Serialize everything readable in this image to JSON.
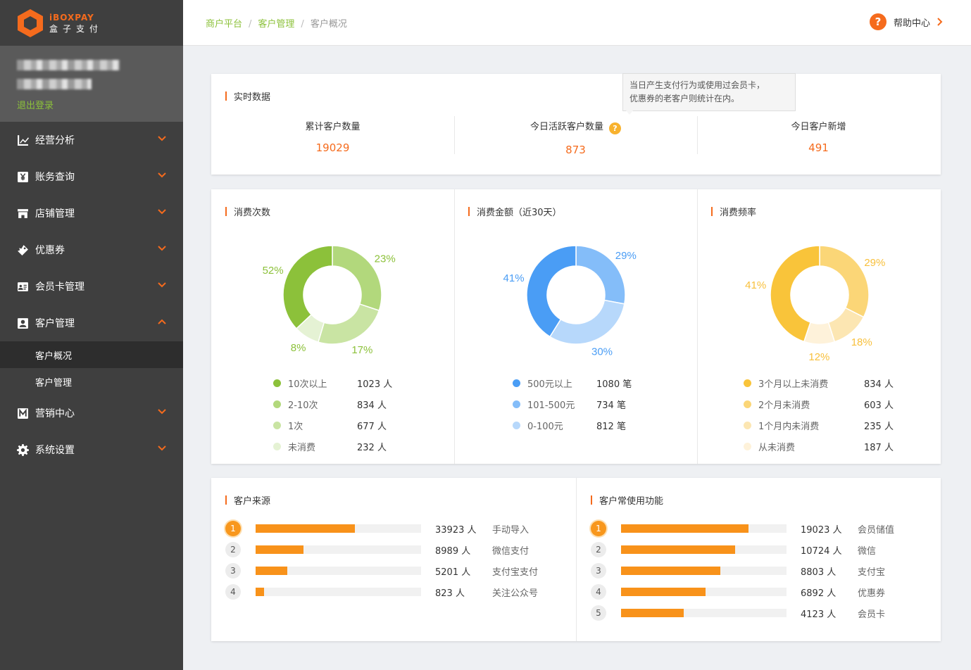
{
  "brand": {
    "logo_text": "iBOXPAY",
    "logo_cn": "盒子支付",
    "accent": "#f56b1d"
  },
  "sidebar": {
    "logout": "退出登录",
    "items": [
      {
        "label": "经营分析",
        "icon": "line-chart-icon"
      },
      {
        "label": "账务查询",
        "icon": "yen-icon"
      },
      {
        "label": "店铺管理",
        "icon": "store-icon"
      },
      {
        "label": "优惠券",
        "icon": "coupon-icon"
      },
      {
        "label": "会员卡管理",
        "icon": "id-card-icon"
      },
      {
        "label": "客户管理",
        "icon": "customer-icon",
        "expanded": true
      },
      {
        "label": "营销中心",
        "icon": "m-icon"
      },
      {
        "label": "系统设置",
        "icon": "gear-icon"
      }
    ],
    "sub_items": [
      {
        "label": "客户概况",
        "active": true
      },
      {
        "label": "客户管理"
      }
    ]
  },
  "breadcrumb": [
    "商户平台",
    "客户管理",
    "客户概况"
  ],
  "help": {
    "label": "帮助中心"
  },
  "realtime": {
    "title": "实时数据",
    "tooltip_line1": "当日产生支付行为或使用过会员卡，",
    "tooltip_line2": "优惠券的老客户则统计在内。",
    "stats": [
      {
        "label": "累计客户数量",
        "value": "19029"
      },
      {
        "label": "今日活跃客户数量",
        "value": "873"
      },
      {
        "label": "今日客户新增",
        "value": "491"
      }
    ]
  },
  "chart_data": [
    {
      "type": "pie",
      "title": "消费次数",
      "categories": [
        "10次以上",
        "2-10次",
        "1次",
        "未消费"
      ],
      "values": [
        1023,
        834,
        677,
        232
      ],
      "percent_labels": [
        "52%",
        "23%",
        "17%",
        "8%"
      ],
      "value_labels": [
        "1023 人",
        "834 人",
        "677 人",
        "232 人"
      ],
      "colors": [
        "#8cc13a",
        "#b2d87c",
        "#c9e4a3",
        "#e5f2d4"
      ],
      "label_color": "#8cc13a"
    },
    {
      "type": "pie",
      "title": "消费金额（近30天）",
      "categories": [
        "500元以上",
        "101-500元",
        "0-100元"
      ],
      "values": [
        1080,
        734,
        812
      ],
      "percent_labels": [
        "41%",
        "29%",
        "30%"
      ],
      "value_labels": [
        "1080 笔",
        "734 笔",
        "812 笔"
      ],
      "colors": [
        "#4a9df5",
        "#84bdf9",
        "#b7d8fb"
      ],
      "label_color": "#4a9df5"
    },
    {
      "type": "pie",
      "title": "消费频率",
      "categories": [
        "3个月以上未消费",
        "2个月未消费",
        "1个月内未消费",
        "从未消费"
      ],
      "values": [
        834,
        603,
        235,
        187
      ],
      "percent_labels": [
        "41%",
        "29%",
        "18%",
        "12%"
      ],
      "value_labels": [
        "834 人",
        "603 人",
        "235 人",
        "187 人"
      ],
      "colors": [
        "#f9c43a",
        "#fbd677",
        "#fce6b2",
        "#fef2da"
      ],
      "label_color": "#f8c03c"
    },
    {
      "type": "bar",
      "title": "客户来源",
      "categories": [
        "手动导入",
        "微信支付",
        "支付宝支付",
        "关注公众号"
      ],
      "values": [
        33923,
        8989,
        5201,
        823
      ],
      "value_labels": [
        "33923 人",
        "8989 人",
        "5201 人",
        "823 人"
      ],
      "fill_ratio": [
        0.6,
        0.29,
        0.19,
        0.05
      ]
    },
    {
      "type": "bar",
      "title": "客户常使用功能",
      "categories": [
        "会员储值",
        "微信",
        "支付宝",
        "优惠券",
        "会员卡"
      ],
      "values": [
        19023,
        10724,
        8803,
        6892,
        4123
      ],
      "value_labels": [
        "19023 人",
        "10724 人",
        "8803 人",
        "6892 人",
        "4123 人"
      ],
      "fill_ratio": [
        0.77,
        0.69,
        0.6,
        0.51,
        0.38
      ]
    }
  ]
}
